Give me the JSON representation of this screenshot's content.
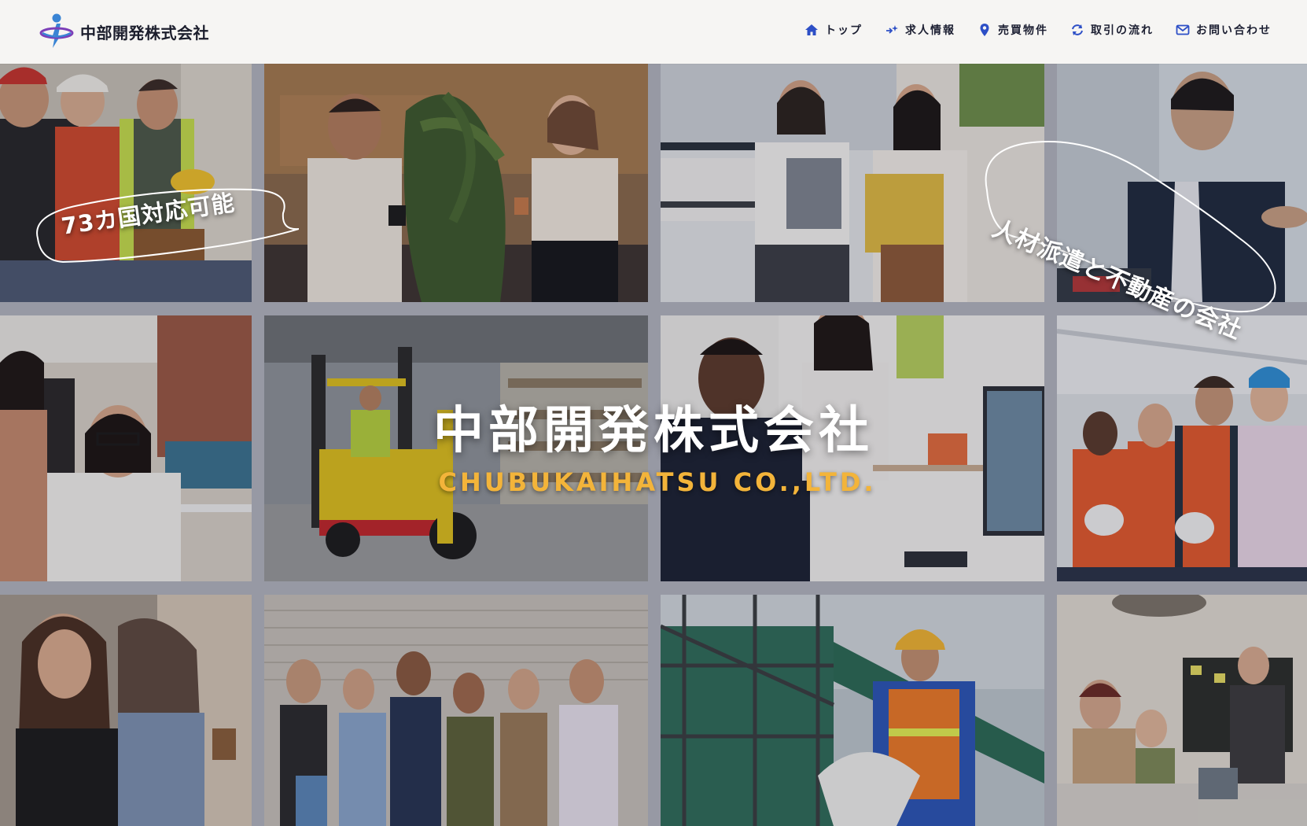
{
  "brand": {
    "name": "中部開発株式会社",
    "logo_icon": "person-orbit-logo",
    "logo_colors": [
      "#3a84d4",
      "#7c3fb8"
    ]
  },
  "nav": {
    "items": [
      {
        "label": "トップ",
        "icon": "home-icon"
      },
      {
        "label": "求人情報",
        "icon": "sparkle-icon"
      },
      {
        "label": "売買物件",
        "icon": "map-pin-icon"
      },
      {
        "label": "取引の流れ",
        "icon": "refresh-icon"
      },
      {
        "label": "お問い合わせ",
        "icon": "mail-icon"
      }
    ],
    "icon_color": "#2d4fc6"
  },
  "hero": {
    "title": "中部開発株式会社",
    "subtitle": "CHUBUKAIHATSU CO.,LTD.",
    "title_color": "#ffffff",
    "subtitle_color": "#f3b43a"
  },
  "badges": {
    "left": "73カ国対応可能",
    "right": "人材派遣と不動産の会社"
  },
  "photos": [
    "construction-workers-photo",
    "office-colleagues-coffee-photo",
    "office-women-documents-photo",
    "businessman-presenting-photo",
    "smiling-office-women-photo",
    "forklift-warehouse-photo",
    "office-team-monitor-photo",
    "safety-vest-team-photo",
    "women-conversation-photo",
    "diverse-group-brick-wall-photo",
    "engineer-blueprint-site-photo",
    "creative-meeting-photo"
  ]
}
